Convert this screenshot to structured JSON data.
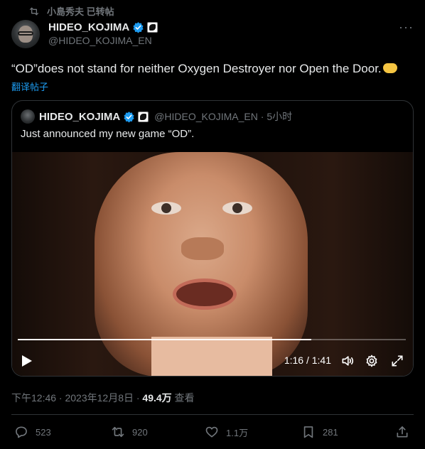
{
  "retweet_banner": {
    "text": "小島秀夫 已转帖"
  },
  "tweet": {
    "author_name": "HIDEO_KOJIMA",
    "author_handle": "@HIDEO_KOJIMA_EN",
    "text": "“OD”does not stand for neither Oxygen Destroyer nor Open the Door.",
    "translate_label": "翻译帖子",
    "timestamp": "下午12:46 · 2023年12月8日 · ",
    "views_count": "49.4万",
    "views_label": " 查看"
  },
  "quoted_tweet": {
    "author_name": "HIDEO_KOJIMA",
    "meta": "@HIDEO_KOJIMA_EN · 5小时",
    "text": "Just announced my new game “OD”.",
    "video": {
      "time": "1:16 / 1:41",
      "progress_fraction": 0.757
    }
  },
  "actions": {
    "replies": "523",
    "reposts": "920",
    "likes": "1.1万",
    "bookmarks": "281"
  },
  "colors": {
    "accent": "#1d9bf0",
    "muted": "#71767b",
    "background": "#000000",
    "border": "#2f3336"
  }
}
